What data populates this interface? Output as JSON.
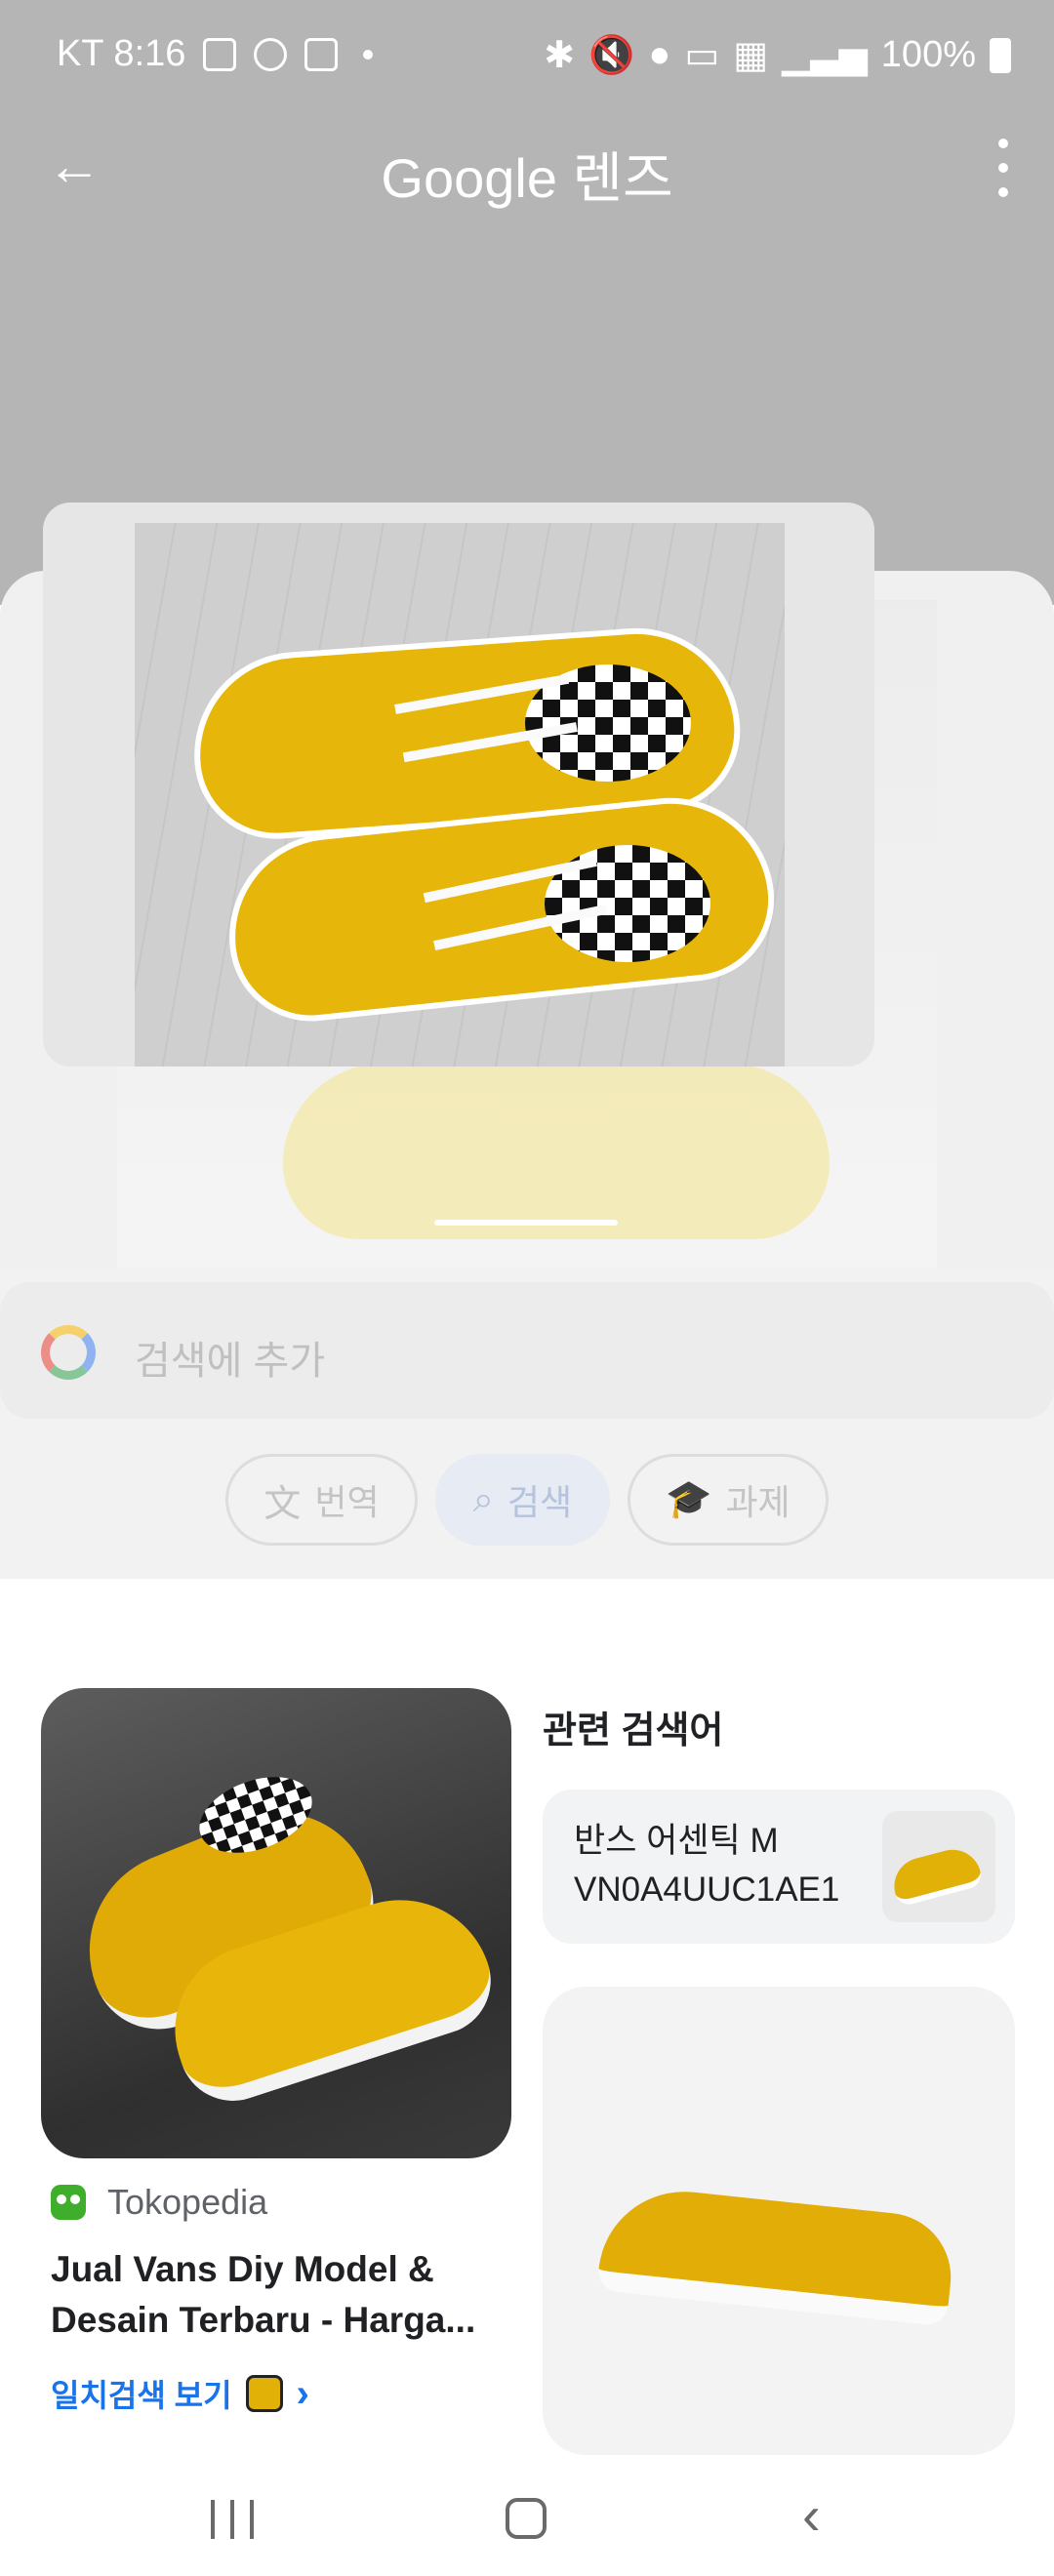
{
  "status_bar": {
    "carrier_time": "KT 8:16",
    "battery": "100%",
    "left_icons": [
      "gallery-icon",
      "talk-icon",
      "instagram-icon",
      "dot-icon"
    ],
    "right_icons": [
      "bluetooth-icon",
      "mute-icon",
      "location-icon",
      "hd-icon",
      "5g-icon",
      "signal-icon",
      "battery-icon"
    ]
  },
  "app_bar": {
    "title": "Google 렌즈",
    "back_icon": "arrow-back-icon",
    "more_icon": "more-vert-icon"
  },
  "search": {
    "placeholder": "검색에 추가"
  },
  "chips": {
    "translate": "번역",
    "search": "검색",
    "homework": "과제"
  },
  "results": {
    "main": {
      "source": "Tokopedia",
      "title": "Jual Vans Diy Model & Desain Terbaru - Harga...",
      "match_link": "일치검색 보기"
    },
    "related_heading": "관련 검색어",
    "related_chip": "반스 어센틱 M VN0A4UUC1AE1"
  },
  "colors": {
    "top_bg": "#b5b5b5",
    "accent_link": "#1a73e8",
    "shoe_yellow": "#e7b60a"
  }
}
